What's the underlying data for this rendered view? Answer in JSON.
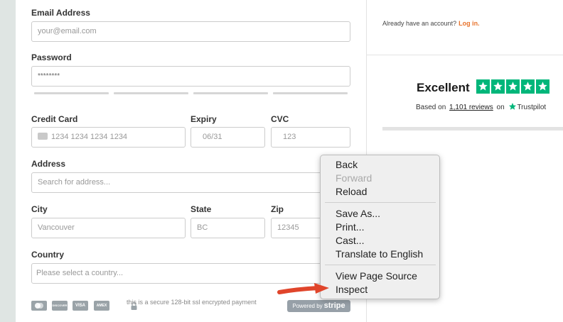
{
  "form": {
    "email": {
      "label": "Email Address",
      "placeholder": "your@email.com"
    },
    "password": {
      "label": "Password",
      "value": "********"
    },
    "credit_card": {
      "label": "Credit Card",
      "placeholder": "1234 1234 1234 1234"
    },
    "expiry": {
      "label": "Expiry",
      "placeholder": "06/31"
    },
    "cvc": {
      "label": "CVC",
      "placeholder": "123"
    },
    "address": {
      "label": "Address",
      "placeholder": "Search for address..."
    },
    "city": {
      "label": "City",
      "placeholder": "Vancouver"
    },
    "state": {
      "label": "State",
      "placeholder": "BC"
    },
    "zip": {
      "label": "Zip",
      "placeholder": "12345"
    },
    "country": {
      "label": "Country",
      "placeholder": "Please select a country..."
    },
    "payment_icons": [
      "mastercard-icon",
      "discover-icon",
      "visa-icon",
      "amex-icon"
    ],
    "payment_icon_labels": [
      "",
      "DISCOVER",
      "VISA",
      "AMEX"
    ],
    "secure_text": "this is a secure 128-bit ssl encrypted payment",
    "stripe_badge": {
      "prefix": "Powered by",
      "brand": "stripe"
    }
  },
  "sidebar": {
    "already_text": "Already have an account?",
    "login_link": "Log in.",
    "rating_word": "Excellent",
    "stars": 5,
    "based_on_prefix": "Based on",
    "reviews_link": "1,101 reviews",
    "on_text": "on",
    "trustpilot": "Trustpilot"
  },
  "context_menu": {
    "items": [
      "Back",
      "Forward",
      "Reload",
      "Save As...",
      "Print...",
      "Cast...",
      "Translate to English",
      "View Page Source",
      "Inspect"
    ],
    "disabled": [
      "Forward"
    ]
  },
  "colors": {
    "accent": "#e8732c",
    "trustpilot_green": "#00b67a",
    "arrow_red": "#e0452b"
  }
}
